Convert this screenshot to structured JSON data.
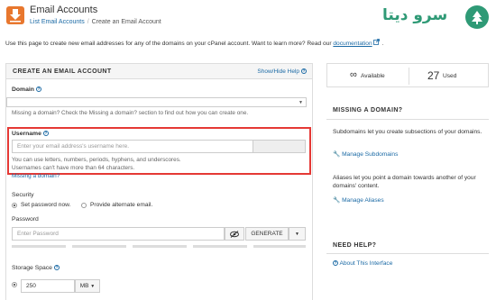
{
  "header": {
    "title": "Email Accounts",
    "breadcrumb_parent": "List Email Accounts",
    "breadcrumb_sep": "/",
    "breadcrumb_current": "Create an Email Account",
    "logo_text": "سرو دیتا"
  },
  "intro": {
    "text": "Use this page to create new email addresses for any of the domains on your cPanel account. Want to learn more? Read our",
    "link": "documentation",
    "suffix": "."
  },
  "form": {
    "title": "CREATE AN EMAIL ACCOUNT",
    "toggle": "Show/Hide Help",
    "domain_label": "Domain",
    "domain_help": "Missing a domain? Check the Missing a domain? section to find out how you can create one.",
    "username_label": "Username",
    "username_placeholder": "Enter your email address's username here.",
    "username_help_1": "You can use letters, numbers, periods, hyphens, and underscores.",
    "username_help_2": "Usernames can't have more than 64 characters.",
    "missing_domain_link": "Missing a domain?",
    "security_label": "Security",
    "security_option_1": "Set password now.",
    "security_option_2": "Provide alternate email.",
    "password_label": "Password",
    "password_placeholder": "Enter Password",
    "generate_label": "GENERATE",
    "storage_label": "Storage Space",
    "storage_value": "250",
    "storage_unit": "MB"
  },
  "stats": {
    "available_symbol": "∞",
    "available_label": "Available",
    "used_value": "27",
    "used_label": "Used"
  },
  "missing_domain": {
    "title": "MISSING A DOMAIN?",
    "text_1": "Subdomains let you create subsections of your domains.",
    "link_1": "Manage Subdomains",
    "text_2": "Aliases let you point a domain towards another of your domains' content.",
    "link_2": "Manage Aliases"
  },
  "need_help": {
    "title": "NEED HELP?",
    "link": "About This Interface"
  },
  "colors": {
    "accent": "#1b6aa5",
    "highlight": "#e53935",
    "brand": "#2f9a76",
    "app_icon": "#e8772e"
  }
}
